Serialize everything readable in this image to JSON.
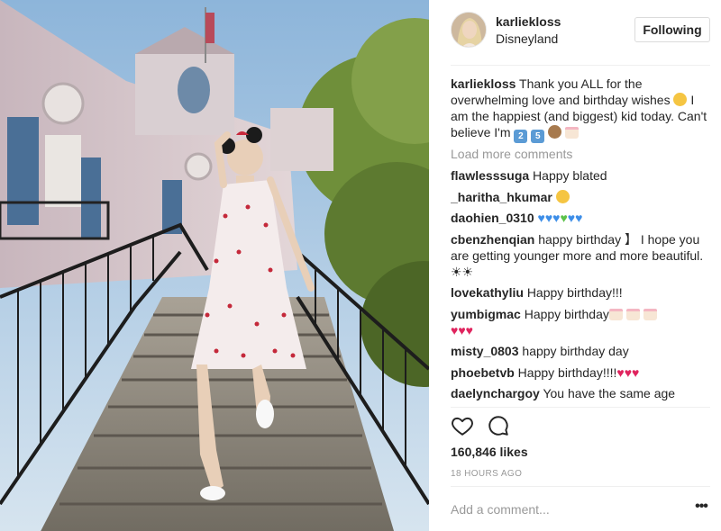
{
  "post": {
    "username": "karliekloss",
    "location": "Disneyland",
    "follow_label": "Following",
    "photo_icon": "disneyland-stairs-photo"
  },
  "caption": {
    "username": "karliekloss",
    "text": "Thank you ALL for the overwhelming love and birthday wishes",
    "text2": "I am the happiest (and biggest) kid today. Can't believe I'm",
    "emoji_digits": [
      "2",
      "5"
    ]
  },
  "load_more": "Load more comments",
  "comments": [
    {
      "user": "flawlesssuga",
      "text": "Happy blated"
    },
    {
      "user": "_haritha_hkumar",
      "text": ""
    },
    {
      "user": "daohien_0310",
      "text": ""
    },
    {
      "user": "cbenzhenqian",
      "text": "happy birthday 】 I hope you are getting younger more and more beautiful. ☀☀"
    },
    {
      "user": "lovekathyliu",
      "text": "Happy birthday!!!"
    },
    {
      "user": "yumbigmac",
      "text": "Happy birthday"
    },
    {
      "user": "misty_0803",
      "text": "happy birthday day"
    },
    {
      "user": "phoebetvb",
      "text": "Happy birthday!!!!"
    },
    {
      "user": "daelynchargoy",
      "text": "You have the same age"
    }
  ],
  "likes": "160,846 likes",
  "time": "18 HOURS AGO",
  "comment_input": {
    "placeholder": "Add a comment..."
  },
  "more_label": "•••",
  "icons": {
    "like": "heart-outline-icon",
    "comment": "speech-bubble-icon",
    "more": "more-options-icon"
  },
  "colors": {
    "text": "#262626",
    "muted": "#999999",
    "border": "#dbdbdb",
    "divider": "#efefef",
    "heart": "#e0245e",
    "blue_heart": "#3d8ee8",
    "green_heart": "#5cc24a"
  }
}
